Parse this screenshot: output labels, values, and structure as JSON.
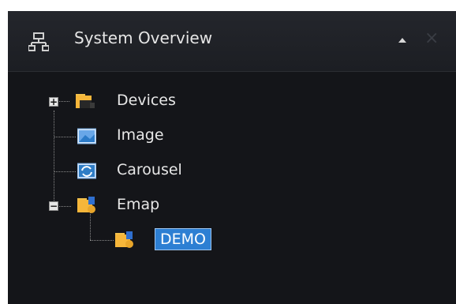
{
  "panel": {
    "title": "System Overview",
    "icons": {
      "title": "network-tree-icon",
      "collapse": "triangle-up-icon",
      "close": "close-icon"
    }
  },
  "tree": {
    "items": [
      {
        "label": "Devices",
        "icon": "folder-camera-icon",
        "expander": "+"
      },
      {
        "label": "Image",
        "icon": "image-icon"
      },
      {
        "label": "Carousel",
        "icon": "carousel-icon"
      },
      {
        "label": "Emap",
        "icon": "folder-map-icon",
        "expander": "−"
      },
      {
        "label": "DEMO",
        "icon": "map-icon",
        "selected": true
      }
    ]
  },
  "colors": {
    "background": "#141519",
    "text": "#e7e7e7",
    "selection": "#2d7fd3"
  }
}
